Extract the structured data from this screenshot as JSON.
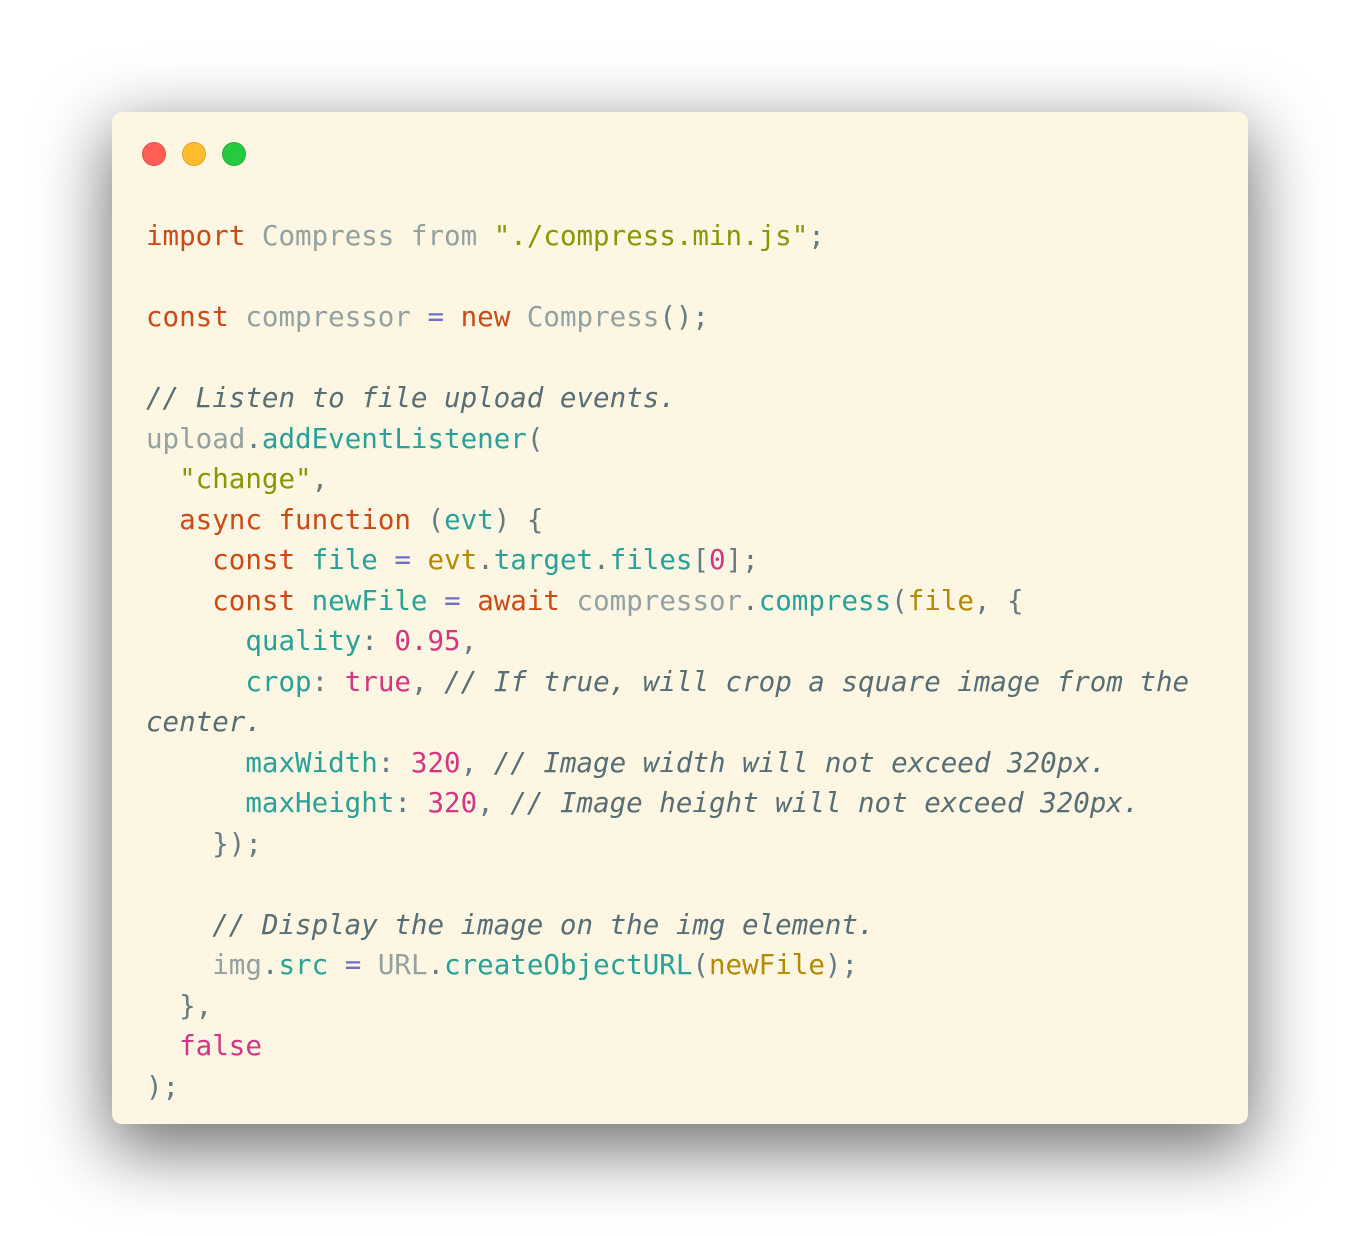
{
  "window": {
    "buttons": {
      "close_color": "#ff5f56",
      "minimize_color": "#ffbd2e",
      "maximize_color": "#27c93f"
    },
    "background": "#fdf6e3"
  },
  "code": {
    "language": "javascript",
    "lines": [
      [
        [
          "kw",
          "import"
        ],
        [
          "pn",
          " "
        ],
        [
          "id",
          "Compress"
        ],
        [
          "pn",
          " "
        ],
        [
          "id",
          "from"
        ],
        [
          "pn",
          " "
        ],
        [
          "str",
          "\"./compress.min.js\""
        ],
        [
          "pn",
          ";"
        ]
      ],
      [],
      [
        [
          "kw",
          "const"
        ],
        [
          "pn",
          " "
        ],
        [
          "id",
          "compressor"
        ],
        [
          "pn",
          " "
        ],
        [
          "op",
          "="
        ],
        [
          "pn",
          " "
        ],
        [
          "kw",
          "new"
        ],
        [
          "pn",
          " "
        ],
        [
          "id",
          "Compress"
        ],
        [
          "pn",
          "();"
        ]
      ],
      [],
      [
        [
          "cm",
          "// Listen to file upload events."
        ]
      ],
      [
        [
          "id",
          "upload"
        ],
        [
          "pn",
          "."
        ],
        [
          "fn",
          "addEventListener"
        ],
        [
          "pn",
          "("
        ]
      ],
      [
        [
          "pn",
          "  "
        ],
        [
          "str",
          "\"change\""
        ],
        [
          "pn",
          ","
        ]
      ],
      [
        [
          "pn",
          "  "
        ],
        [
          "kw",
          "async"
        ],
        [
          "pn",
          " "
        ],
        [
          "kw",
          "function"
        ],
        [
          "pn",
          " ("
        ],
        [
          "fn",
          "evt"
        ],
        [
          "pn",
          ") {"
        ]
      ],
      [
        [
          "pn",
          "    "
        ],
        [
          "kw",
          "const"
        ],
        [
          "pn",
          " "
        ],
        [
          "fn",
          "file"
        ],
        [
          "pn",
          " "
        ],
        [
          "op",
          "="
        ],
        [
          "pn",
          " "
        ],
        [
          "prm",
          "evt"
        ],
        [
          "pn",
          "."
        ],
        [
          "fn",
          "target"
        ],
        [
          "pn",
          "."
        ],
        [
          "fn",
          "files"
        ],
        [
          "pn",
          "["
        ],
        [
          "num",
          "0"
        ],
        [
          "pn",
          "];"
        ]
      ],
      [
        [
          "pn",
          "    "
        ],
        [
          "kw",
          "const"
        ],
        [
          "pn",
          " "
        ],
        [
          "fn",
          "newFile"
        ],
        [
          "pn",
          " "
        ],
        [
          "op",
          "="
        ],
        [
          "pn",
          " "
        ],
        [
          "kw",
          "await"
        ],
        [
          "pn",
          " "
        ],
        [
          "id",
          "compressor"
        ],
        [
          "pn",
          "."
        ],
        [
          "fn",
          "compress"
        ],
        [
          "pn",
          "("
        ],
        [
          "prm",
          "file"
        ],
        [
          "pn",
          ", {"
        ]
      ],
      [
        [
          "pn",
          "      "
        ],
        [
          "fn",
          "quality"
        ],
        [
          "pn",
          ": "
        ],
        [
          "num",
          "0.95"
        ],
        [
          "pn",
          ","
        ]
      ],
      [
        [
          "pn",
          "      "
        ],
        [
          "fn",
          "crop"
        ],
        [
          "pn",
          ": "
        ],
        [
          "num",
          "true"
        ],
        [
          "pn",
          ", "
        ],
        [
          "cm",
          "// If true, will crop a square image from the"
        ]
      ],
      [
        [
          "cm",
          "center."
        ]
      ],
      [
        [
          "pn",
          "      "
        ],
        [
          "fn",
          "maxWidth"
        ],
        [
          "pn",
          ": "
        ],
        [
          "num",
          "320"
        ],
        [
          "pn",
          ", "
        ],
        [
          "cm",
          "// Image width will not exceed 320px."
        ]
      ],
      [
        [
          "pn",
          "      "
        ],
        [
          "fn",
          "maxHeight"
        ],
        [
          "pn",
          ": "
        ],
        [
          "num",
          "320"
        ],
        [
          "pn",
          ", "
        ],
        [
          "cm",
          "// Image height will not exceed 320px."
        ]
      ],
      [
        [
          "pn",
          "    });"
        ]
      ],
      [],
      [
        [
          "pn",
          "    "
        ],
        [
          "cm",
          "// Display the image on the img element."
        ]
      ],
      [
        [
          "pn",
          "    "
        ],
        [
          "id",
          "img"
        ],
        [
          "pn",
          "."
        ],
        [
          "fn",
          "src"
        ],
        [
          "pn",
          " "
        ],
        [
          "op",
          "="
        ],
        [
          "pn",
          " "
        ],
        [
          "id",
          "URL"
        ],
        [
          "pn",
          "."
        ],
        [
          "fn",
          "createObjectURL"
        ],
        [
          "pn",
          "("
        ],
        [
          "prm",
          "newFile"
        ],
        [
          "pn",
          ");"
        ]
      ],
      [
        [
          "pn",
          "  },"
        ]
      ],
      [
        [
          "pn",
          "  "
        ],
        [
          "num",
          "false"
        ]
      ],
      [
        [
          "pn",
          ");"
        ]
      ]
    ]
  }
}
